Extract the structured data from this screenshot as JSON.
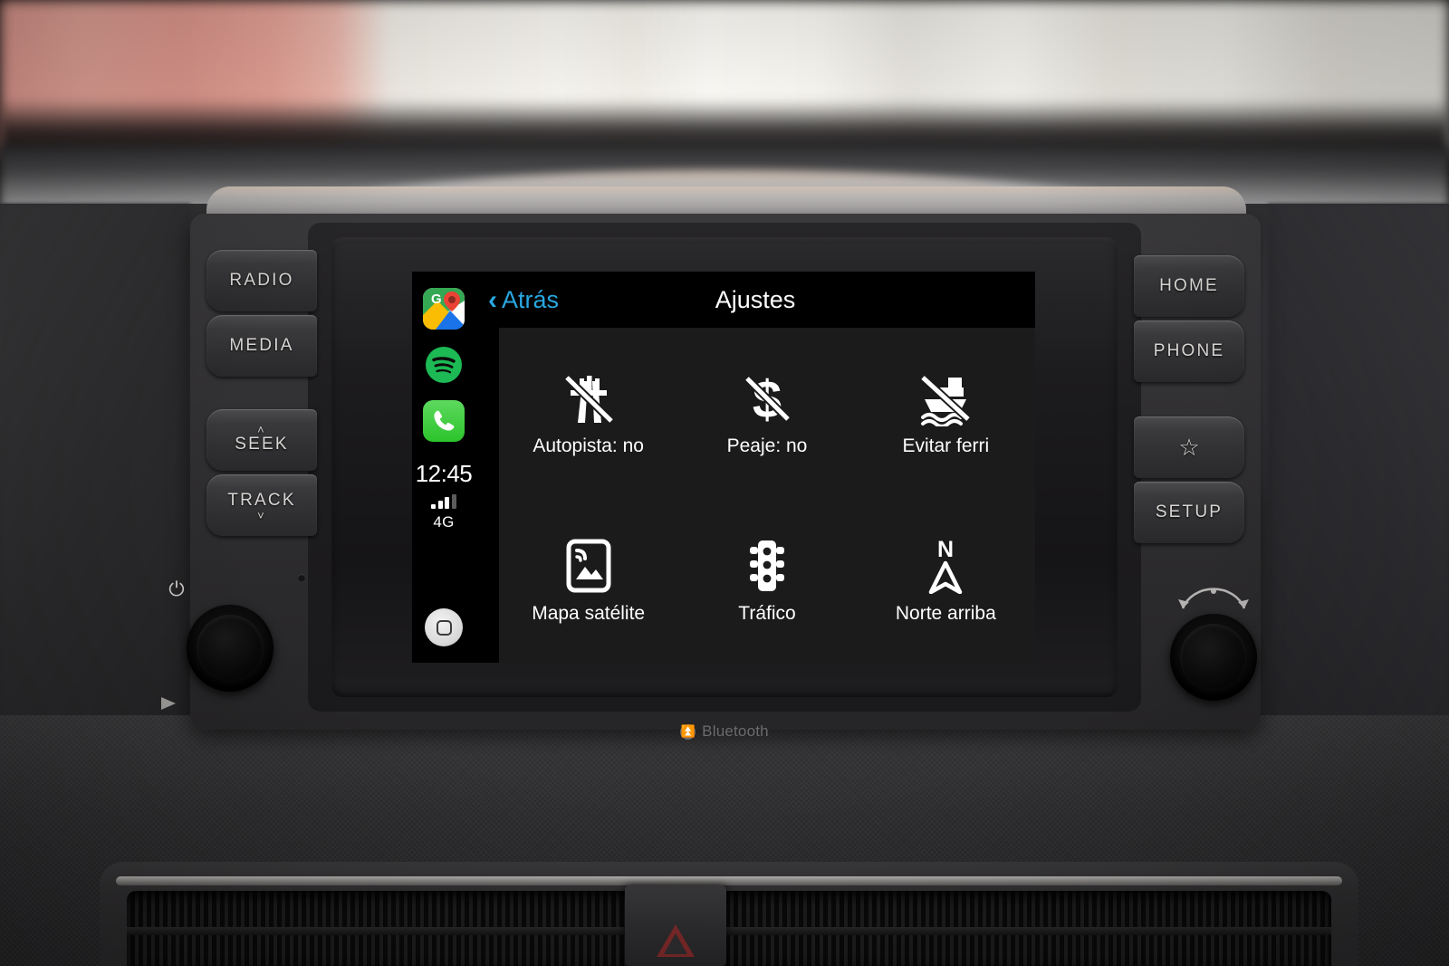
{
  "head_unit": {
    "brand_badge": "Bluetooth",
    "left_buttons": [
      {
        "label": "RADIO",
        "name": "radio-button",
        "chevron": ""
      },
      {
        "label": "MEDIA",
        "name": "media-button",
        "chevron": ""
      },
      {
        "label": "SEEK",
        "name": "seek-button",
        "chevron": "˄",
        "chevron_pos": "top"
      },
      {
        "label": "TRACK",
        "name": "track-button",
        "chevron": "˅",
        "chevron_pos": "bottom"
      }
    ],
    "right_buttons": [
      {
        "label": "HOME",
        "name": "home-button"
      },
      {
        "label": "PHONE",
        "name": "phone-button"
      },
      {
        "label": "☆",
        "name": "favorites-star-button"
      },
      {
        "label": "SETUP",
        "name": "setup-button"
      }
    ],
    "left_knob": {
      "name": "power-volume-knob",
      "icon": "power-icon"
    },
    "right_knob": {
      "name": "tune-scan-knob",
      "icon": "tune-arc-icon"
    }
  },
  "carplay": {
    "sidebar": {
      "apps": [
        {
          "name": "google-maps-app-icon",
          "label": "Google Maps"
        },
        {
          "name": "spotify-app-icon",
          "label": "Spotify"
        },
        {
          "name": "phone-app-icon",
          "label": "Phone"
        }
      ],
      "time": "12:45",
      "signal_bars": 3,
      "signal_bars_total": 4,
      "network": "4G",
      "home_button": "home-indicator-button"
    },
    "header": {
      "back_label": "Atrás",
      "back_chevron": "‹",
      "title": "Ajustes",
      "accent_color": "#28a7e0"
    },
    "settings_grid": [
      {
        "label": "Autopista: no",
        "icon": "no-highway-icon",
        "name": "setting-avoid-highway"
      },
      {
        "label": "Peaje: no",
        "icon": "no-toll-icon",
        "name": "setting-avoid-toll"
      },
      {
        "label": "Evitar ferri",
        "icon": "no-ferry-icon",
        "name": "setting-avoid-ferry"
      },
      {
        "label": "Mapa satélite",
        "icon": "satellite-map-icon",
        "name": "setting-satellite-map"
      },
      {
        "label": "Tráfico",
        "icon": "traffic-light-icon",
        "name": "setting-traffic"
      },
      {
        "label": "Norte arriba",
        "icon": "north-up-icon",
        "name": "setting-north-up"
      }
    ]
  }
}
